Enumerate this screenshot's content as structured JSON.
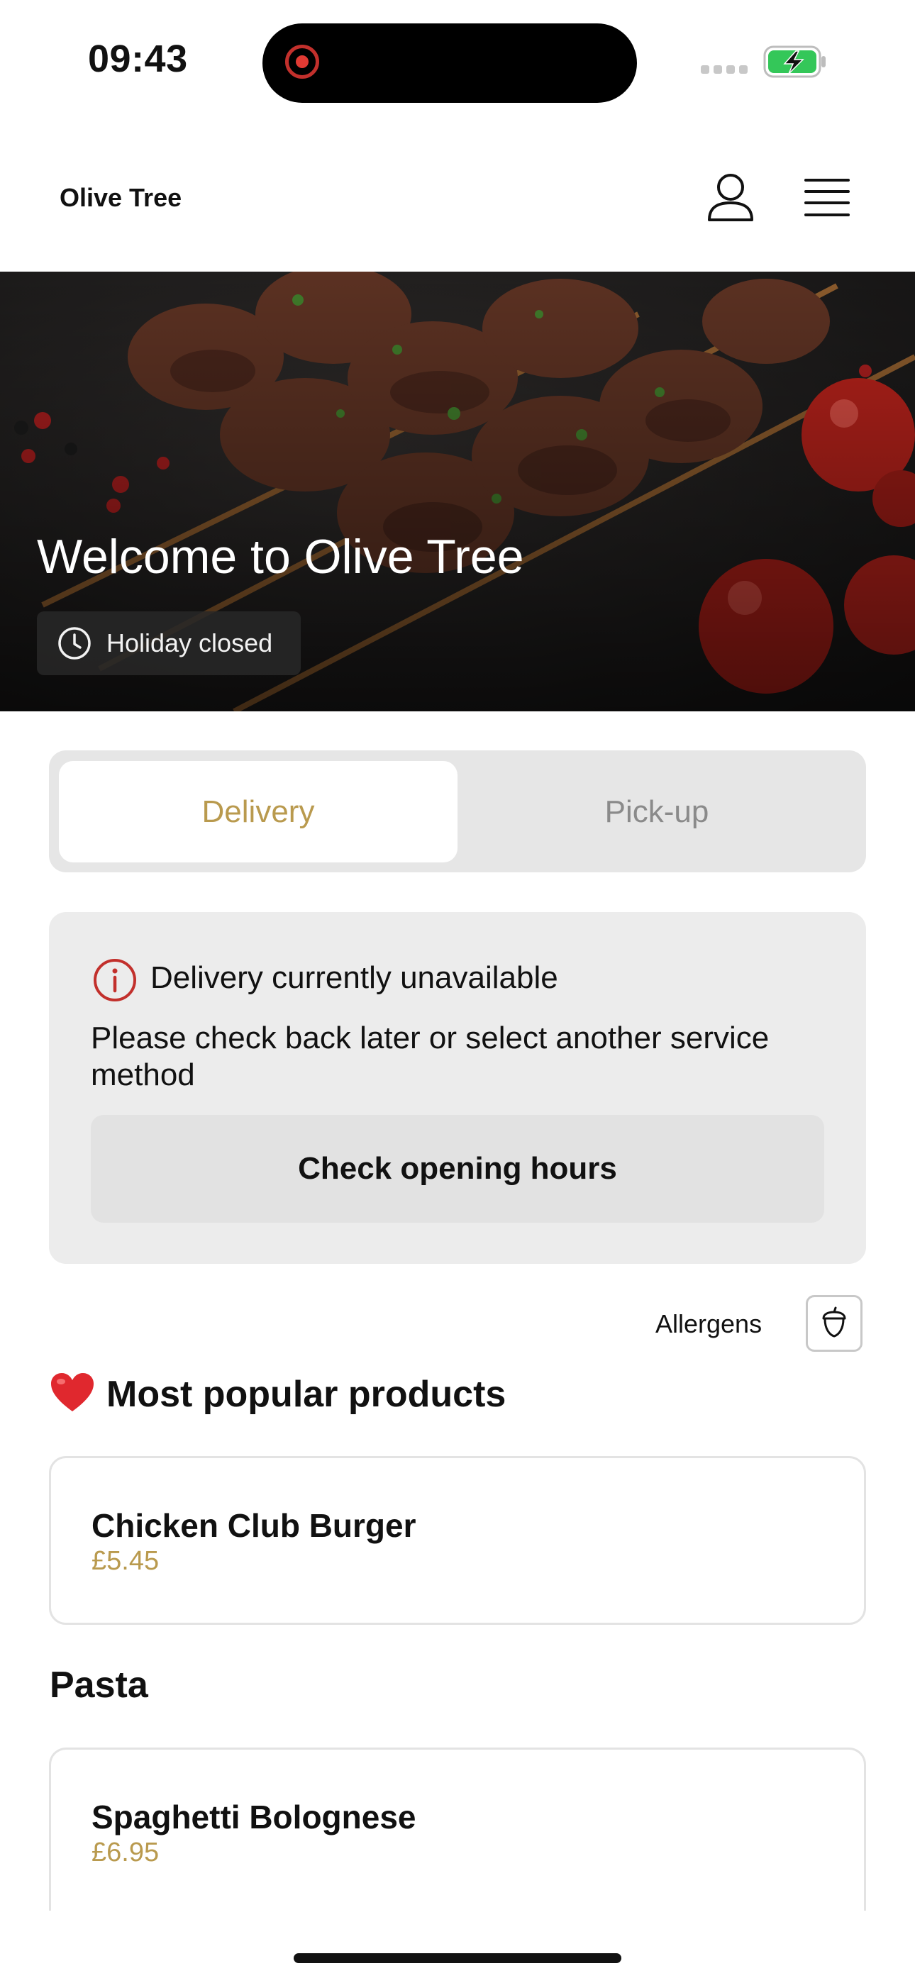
{
  "status_bar": {
    "time": "09:43"
  },
  "header": {
    "brand": "Olive Tree",
    "icons": [
      "user-icon",
      "menu-icon"
    ]
  },
  "hero": {
    "title": "Welcome to Olive Tree",
    "badge": "Holiday closed"
  },
  "service_toggle": {
    "options": [
      "Delivery",
      "Pick-up"
    ],
    "selected": "Delivery"
  },
  "notice": {
    "title": "Delivery currently unavailable",
    "body": "Please check back later or select another service method",
    "button": "Check opening hours"
  },
  "allergens": {
    "label": "Allergens"
  },
  "sections": [
    {
      "title": "Most popular products",
      "items": [
        {
          "name": "Chicken Club Burger",
          "price": "£5.45"
        }
      ]
    },
    {
      "title": "Pasta",
      "items": [
        {
          "name": "Spaghetti Bolognese",
          "price": "£6.95"
        }
      ]
    }
  ],
  "colors": {
    "accent": "#b99a4e",
    "alert": "#c2302c"
  }
}
